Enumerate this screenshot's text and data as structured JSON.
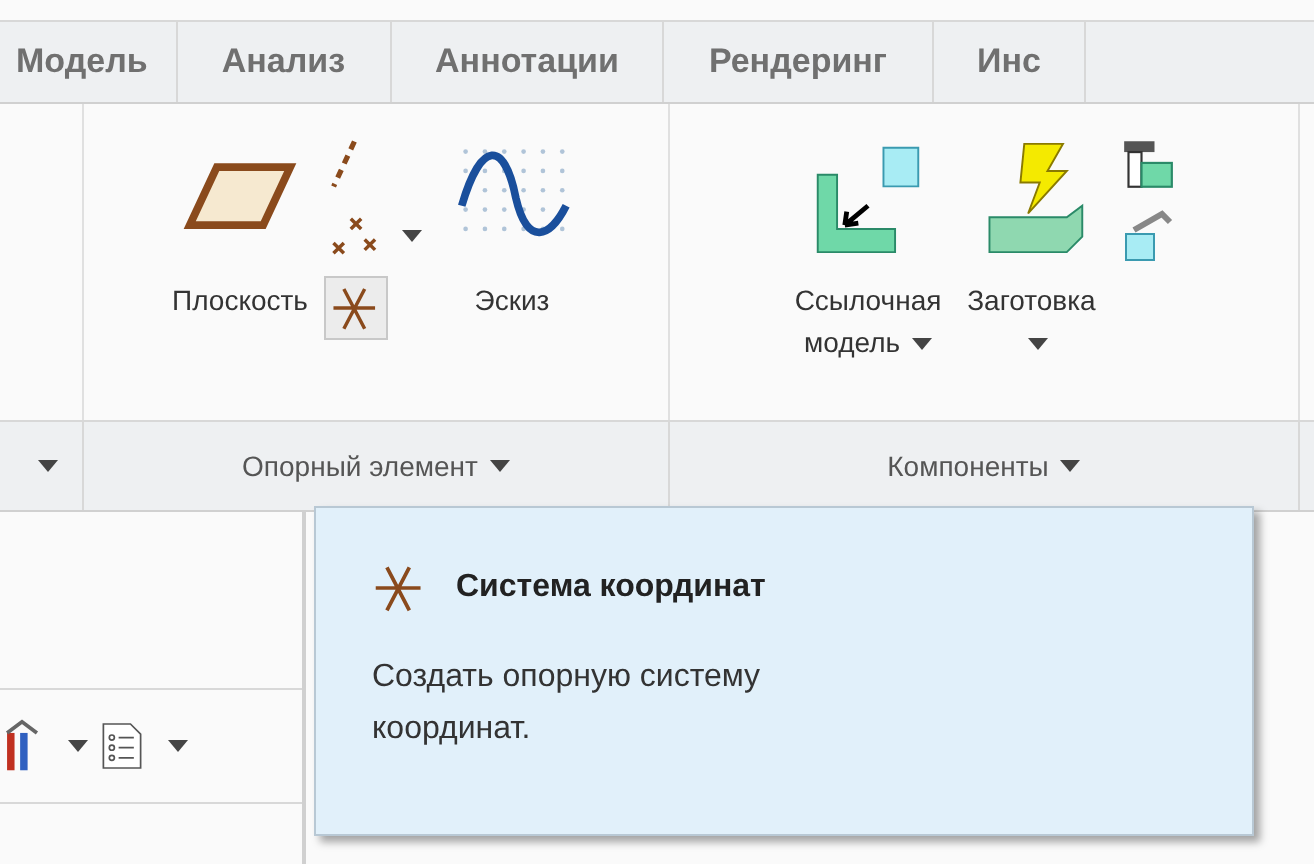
{
  "tabs": [
    {
      "label": "Модель"
    },
    {
      "label": "Анализ"
    },
    {
      "label": "Аннотации"
    },
    {
      "label": "Рендеринг"
    },
    {
      "label": "Инс"
    }
  ],
  "ribbon": {
    "groups": [
      {
        "label": "Опорный элемент",
        "buttons": [
          {
            "kind": "large",
            "label": "Плоскость",
            "dropdown": false
          },
          {
            "kind": "stack",
            "items": [
              {
                "dropdown": false,
                "hovered": false
              },
              {
                "dropdown": true,
                "hovered": false
              },
              {
                "dropdown": false,
                "hovered": true
              }
            ]
          },
          {
            "kind": "large",
            "label": "Эскиз",
            "dropdown": false
          }
        ]
      },
      {
        "label": "Компоненты",
        "buttons": [
          {
            "kind": "large",
            "label": "Ссылочная модель",
            "dropdown": true
          },
          {
            "kind": "large",
            "label": "Заготовка",
            "dropdown": true
          },
          {
            "kind": "stack",
            "items": [
              {
                "dropdown": false,
                "hovered": false
              },
              {
                "dropdown": false,
                "hovered": false
              }
            ]
          }
        ]
      }
    ]
  },
  "tooltip": {
    "title": "Система координат",
    "text": "Создать опорную систему координат."
  }
}
